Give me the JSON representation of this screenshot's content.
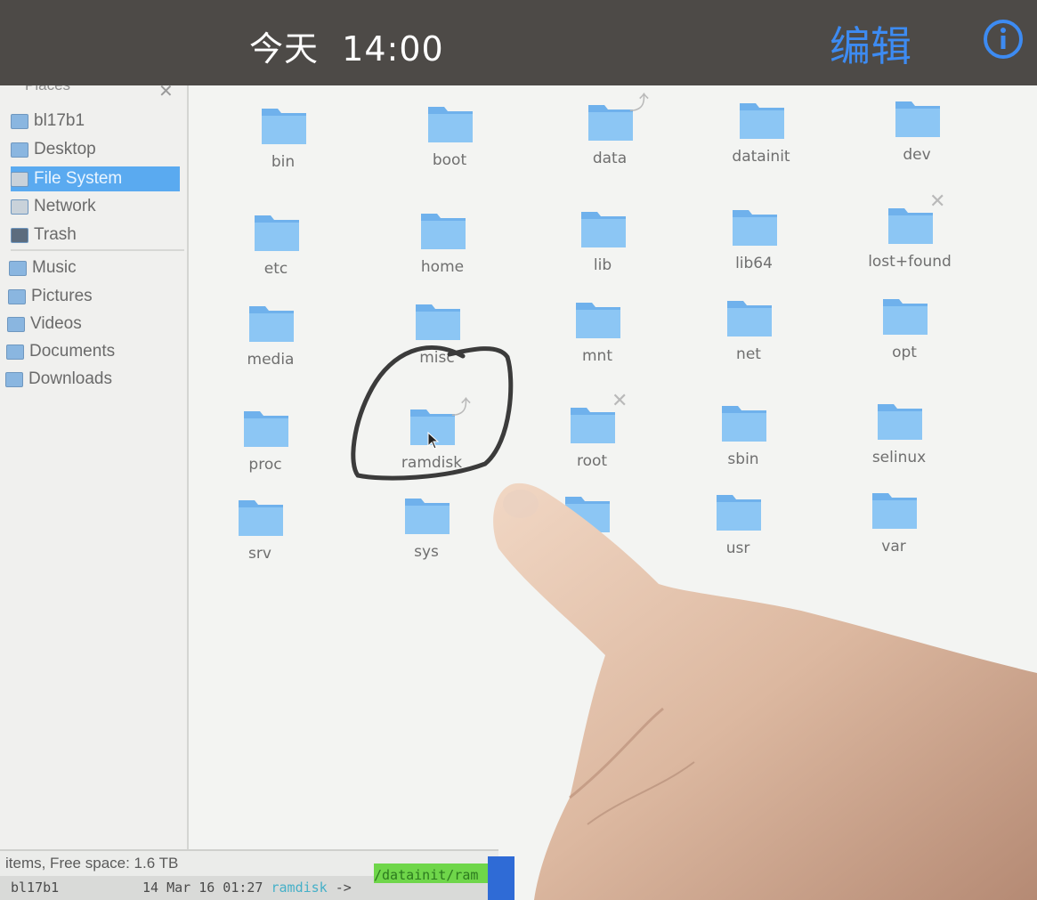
{
  "viewer": {
    "title": "今天  14:00",
    "edit_label": "编辑",
    "info_icon": "info-circle-icon",
    "accent_color": "#3d8bf2"
  },
  "file_manager": {
    "sidebar": {
      "header": "Places",
      "items": [
        {
          "label": "bl17b1",
          "icon": "home-folder-icon"
        },
        {
          "label": "Desktop",
          "icon": "desktop-icon"
        },
        {
          "label": "File System",
          "icon": "drive-icon",
          "selected": true
        },
        {
          "label": "Network",
          "icon": "network-icon"
        },
        {
          "label": "Trash",
          "icon": "trash-icon"
        },
        {
          "label": "Music",
          "icon": "folder-music-icon"
        },
        {
          "label": "Pictures",
          "icon": "folder-pictures-icon"
        },
        {
          "label": "Videos",
          "icon": "folder-videos-icon"
        },
        {
          "label": "Documents",
          "icon": "folder-documents-icon"
        },
        {
          "label": "Downloads",
          "icon": "folder-downloads-icon"
        }
      ]
    },
    "folders": [
      {
        "label": "bin"
      },
      {
        "label": "boot"
      },
      {
        "label": "data",
        "emblem": "symlink"
      },
      {
        "label": "datainit"
      },
      {
        "label": "dev"
      },
      {
        "label": "etc"
      },
      {
        "label": "home"
      },
      {
        "label": "lib"
      },
      {
        "label": "lib64"
      },
      {
        "label": "lost+found",
        "emblem": "locked"
      },
      {
        "label": "media"
      },
      {
        "label": "misc"
      },
      {
        "label": "mnt"
      },
      {
        "label": "net"
      },
      {
        "label": "opt"
      },
      {
        "label": "proc"
      },
      {
        "label": "ramdisk",
        "emblem": "symlink",
        "circled": true
      },
      {
        "label": "root",
        "emblem": "locked"
      },
      {
        "label": "sbin"
      },
      {
        "label": "selinux"
      },
      {
        "label": "srv"
      },
      {
        "label": "sys"
      },
      {
        "label": ""
      },
      {
        "label": "usr"
      },
      {
        "label": "var"
      }
    ],
    "status_text": "items, Free space: 1.6 TB",
    "terminal": {
      "name": "bl17b1",
      "date": "14 Mar 16 01:27",
      "link": "ramdisk",
      "arrow": "->",
      "target": "/datainit/ram"
    },
    "folder_color": "#7fbdf0",
    "selection_color": "#5aaaf0"
  }
}
